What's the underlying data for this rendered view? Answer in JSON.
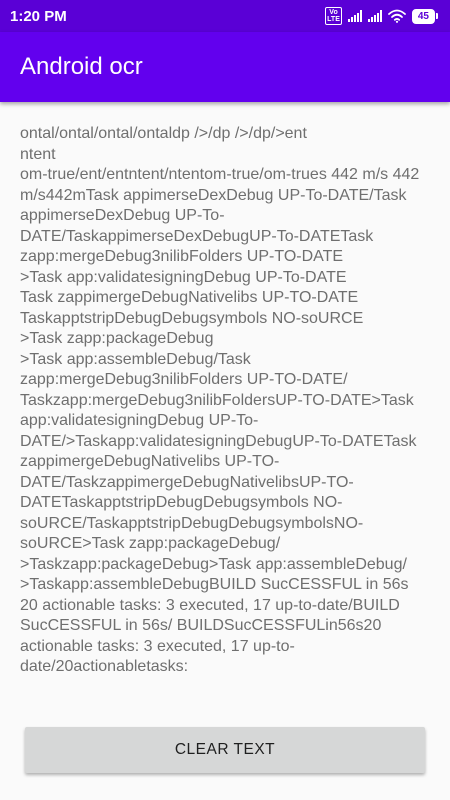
{
  "status_bar": {
    "time": "1:20 PM",
    "volte_label_top": "Vo",
    "volte_label_bottom": "LTE",
    "battery_level": "45",
    "icons": [
      "volte-icon",
      "signal-icon",
      "signal-icon",
      "wifi-icon",
      "battery-icon"
    ]
  },
  "app_bar": {
    "title": "Android ocr"
  },
  "content": {
    "ocr_text": "ontal/ontal/ontal/ontaldp />/dp />/dp/>ent\nntent\nom-true/ent/entntent/ntentom-true/om-trues 442 m/s 442 m/s442mTask appimerseDexDebug UP-To-DATE/Task appimerseDexDebug UP-To-DATE/TaskappimerseDexDebugUP-To-DATETask zapp:mergeDebug3nilibFolders UP-TO-DATE\n>Task app:validatesigningDebug UP-To-DATE\nTask zappimergeDebugNativelibs UP-TO-DATE\nTaskapptstripDebugDebugsymbols NO-soURCE\n>Task zapp:packageDebug\n>Task app:assembleDebug/Task zapp:mergeDebug3nilibFolders UP-TO-DATE/ Taskzapp:mergeDebug3nilibFoldersUP-TO-DATE>Task app:validatesigningDebug UP-To-DATE/>Taskapp:validatesigningDebugUP-To-DATETask zappimergeDebugNativelibs UP-TO-DATE/TaskzappimergeDebugNativelibsUP-TO-DATETaskapptstripDebugDebugsymbols NO-soURCE/TaskapptstripDebugDebugsymbolsNO-soURCE>Task zapp:packageDebug/ >Taskzapp:packageDebug>Task app:assembleDebug/ >Taskapp:assembleDebugBUILD SucCESSFUL in 56s 20 actionable tasks: 3 executed, 17 up-to-date/BUILD SucCESSFUL in 56s/ BUILDSucCESSFULin56s20 actionable tasks: 3 executed, 17 up-to-date/20actionabletasks:"
  },
  "actions": {
    "clear_label": "CLEAR TEXT"
  },
  "colors": {
    "status_bar": "#5a00d6",
    "app_bar": "#6200ee",
    "button": "#d6d7d7",
    "text": "#6f6f6f"
  }
}
